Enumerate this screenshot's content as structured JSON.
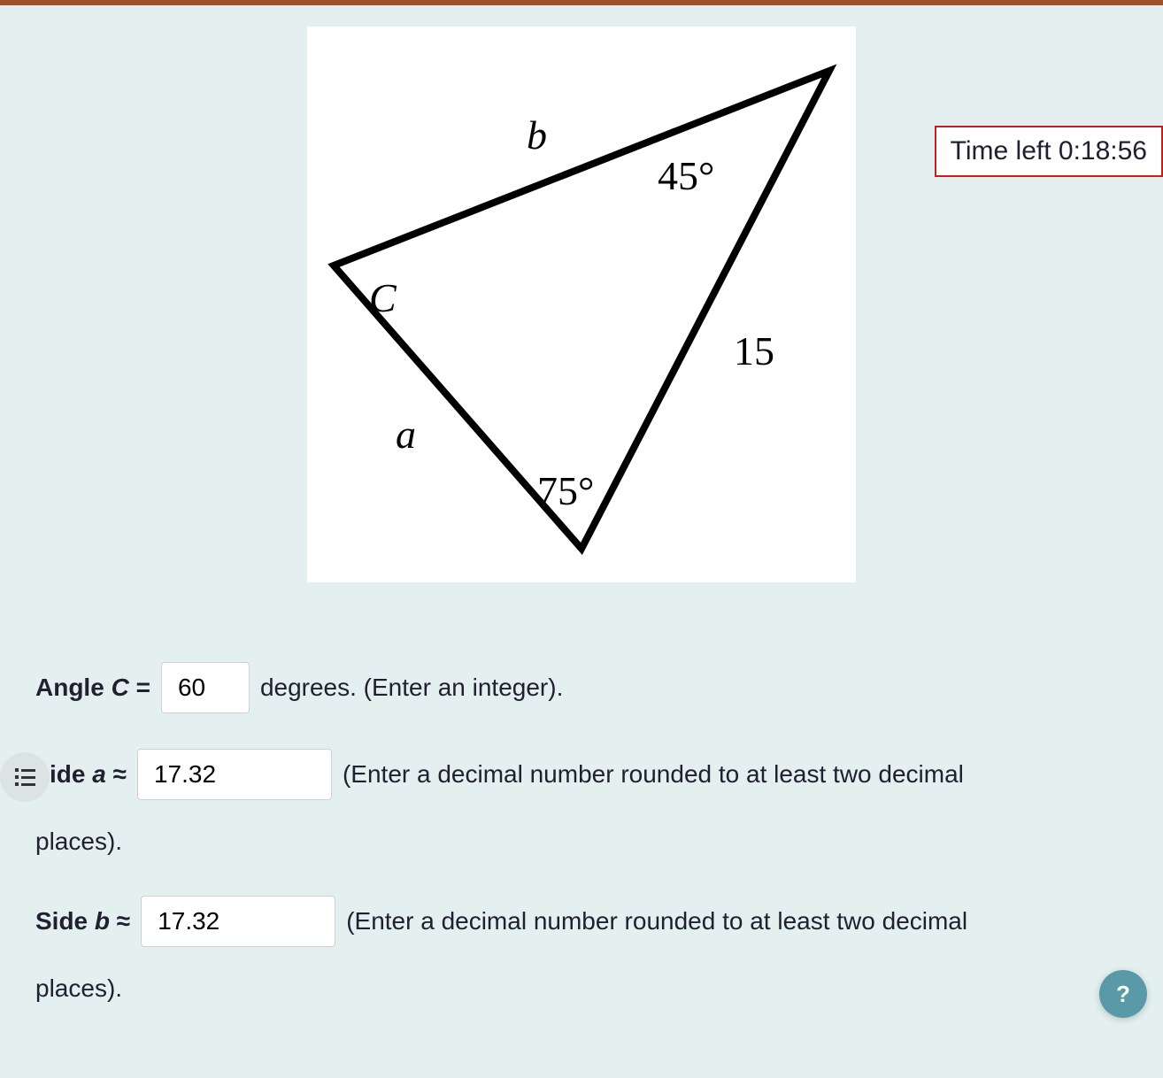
{
  "timer": {
    "text": "Time left 0:18:56"
  },
  "triangle": {
    "label_b": "b",
    "angle_45": "45°",
    "label_C": "C",
    "side_15": "15",
    "label_a": "a",
    "angle_75": "75°"
  },
  "q_angle_c": {
    "label_pre": "Angle ",
    "label_var": "C",
    "label_eq": " = ",
    "value": "60",
    "suffix": "degrees. (Enter an integer)."
  },
  "q_side_a": {
    "label_pre": "ide ",
    "label_var": "a",
    "label_approx": " ≈ ",
    "value": "17.32",
    "suffix": "(Enter a decimal number rounded to at least two decimal",
    "suffix2": "places)."
  },
  "q_side_b": {
    "label_pre": "Side ",
    "label_var": "b",
    "label_approx": " ≈ ",
    "value": "17.32",
    "suffix": "(Enter a decimal number rounded to at least two decimal",
    "suffix2": "places)."
  },
  "help": {
    "label": "?"
  }
}
